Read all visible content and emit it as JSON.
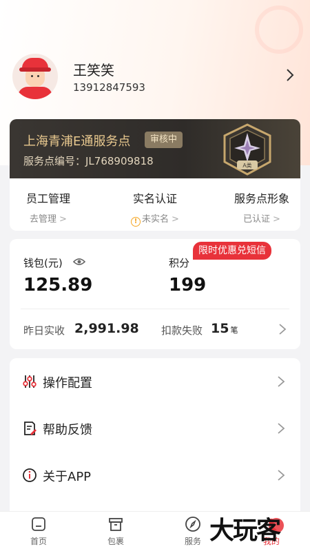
{
  "profile": {
    "name": "王笑笑",
    "phone": "13912847593"
  },
  "store": {
    "name": "上海青浦E通服务点",
    "status_badge": "审核中",
    "number_label": "服务点编号：JL768909818",
    "medal_text": "A类"
  },
  "stats": [
    {
      "title": "员工管理",
      "sub": "去管理"
    },
    {
      "title": "实名认证",
      "sub": "未实名",
      "warn": "!"
    },
    {
      "title": "服务点形象",
      "sub": "已认证"
    }
  ],
  "wallet": {
    "promo": "限时优惠兑短信",
    "wallet_label": "钱包(元)",
    "wallet_value": "125.89",
    "points_label": "积分",
    "points_value": "199",
    "yesterday_label": "昨日实收",
    "yesterday_value": "2,991.98",
    "failed_label": "扣款失败",
    "failed_value": "15",
    "failed_unit": "笔"
  },
  "menu": [
    {
      "label": "操作配置",
      "icon": "sliders-icon"
    },
    {
      "label": "帮助反馈",
      "icon": "feedback-icon"
    },
    {
      "label": "关于APP",
      "icon": "info-icon"
    }
  ],
  "tabs": [
    {
      "label": "首页",
      "icon": "home-icon"
    },
    {
      "label": "包裹",
      "icon": "package-icon"
    },
    {
      "label": "服务",
      "icon": "compass-icon"
    },
    {
      "label": "我的",
      "icon": "user-icon"
    }
  ],
  "watermark": "大玩客",
  "colors": {
    "accent": "#e8323a",
    "gold": "#e9c98f",
    "dark_card": "#312e2a",
    "background": "#f3f3f5"
  }
}
